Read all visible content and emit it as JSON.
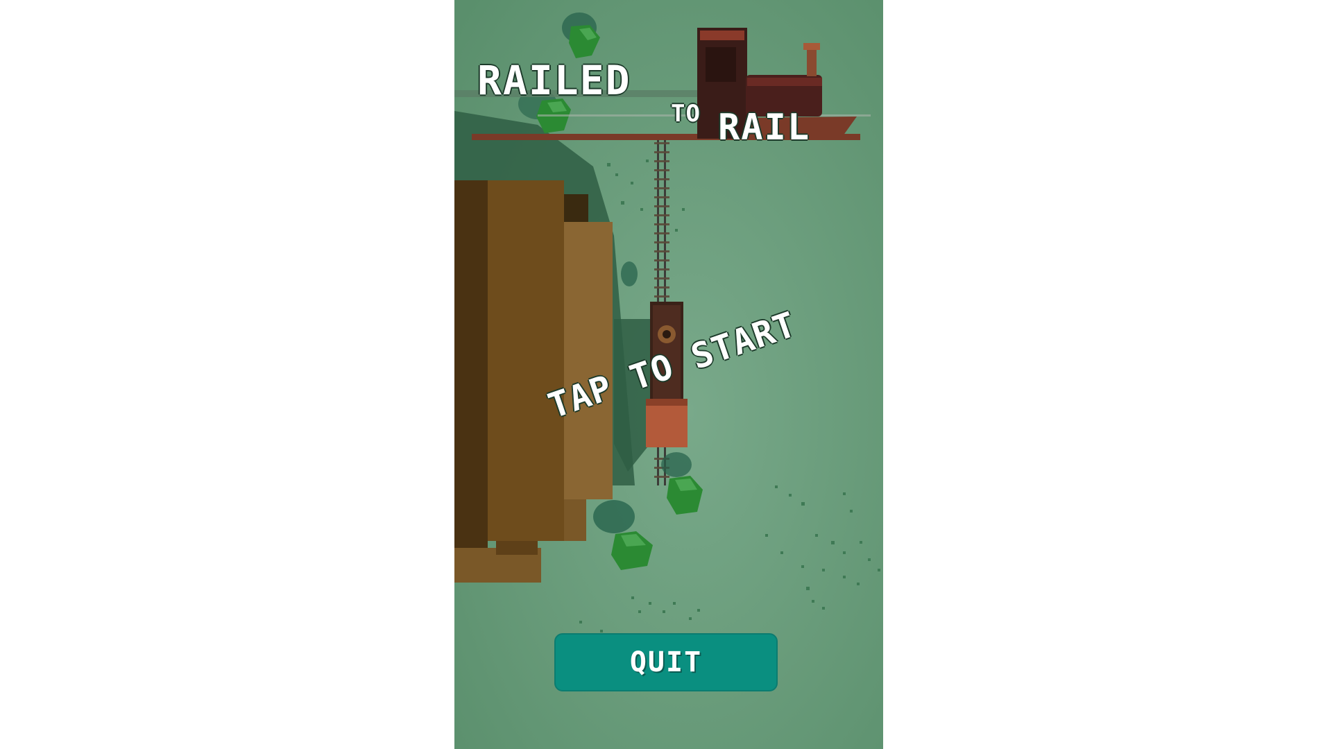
{
  "title": {
    "line1": "RAILED",
    "connector": "TO",
    "line2": "RAIL"
  },
  "prompt": {
    "tap_to_start": "TAP TO START"
  },
  "buttons": {
    "quit_label": "QUIT"
  },
  "colors": {
    "ground": "#649a76",
    "button": "#0a8f80",
    "crate": "#6a4a1e",
    "train": "#4a2a20",
    "tree": "#2e8a34",
    "text": "#ffffff"
  },
  "icons": {
    "logo_locomotive": "steam-locomotive-icon",
    "train_on_track": "train-topdown-icon"
  }
}
